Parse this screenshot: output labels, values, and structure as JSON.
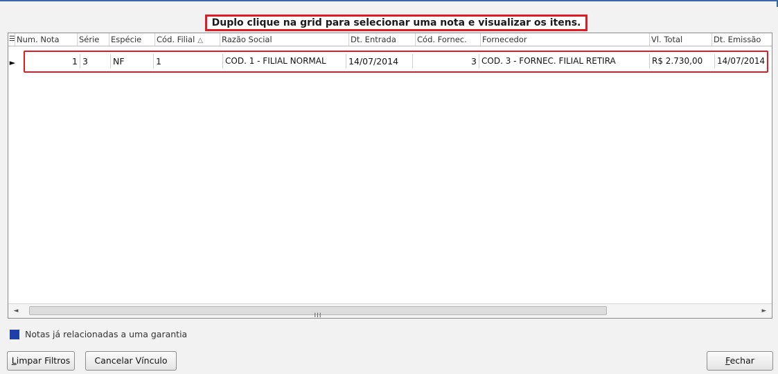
{
  "instruction": "Duplo clique na grid para selecionar uma nota e visualizar os itens.",
  "grid": {
    "columns": [
      {
        "label": "Num. Nota"
      },
      {
        "label": "Série"
      },
      {
        "label": "Espécie"
      },
      {
        "label": "Cód. Filial",
        "sort_indicator": "△"
      },
      {
        "label": "Razão Social"
      },
      {
        "label": "Dt. Entrada"
      },
      {
        "label": "Cód. Fornec."
      },
      {
        "label": "Fornecedor"
      },
      {
        "label": "Vl. Total"
      },
      {
        "label": "Dt. Emissão"
      }
    ],
    "rows": [
      {
        "num_nota": "1",
        "serie": "3",
        "especie": "NF",
        "cod_filial": "1",
        "razao_social": "COD. 1 - FILIAL NORMAL",
        "dt_entrada": "14/07/2014",
        "cod_fornec": "3",
        "fornecedor": "COD. 3 - FORNEC. FILIAL RETIRA",
        "vl_total": "R$ 2.730,00",
        "dt_emissao": "14/07/2014"
      }
    ],
    "scrollbar": {
      "left_arrow": "◄",
      "right_arrow": "►",
      "grip": "III"
    }
  },
  "legend": {
    "label": "Notas já relacionadas a uma garantia",
    "color": "#1f3fa8"
  },
  "buttons": {
    "limpar": "Limpar Filtros",
    "cancelar": "Cancelar Vínculo",
    "fechar": "Fechar"
  },
  "colors": {
    "highlight": "#e01b24",
    "window_accent": "#3a66b0"
  }
}
